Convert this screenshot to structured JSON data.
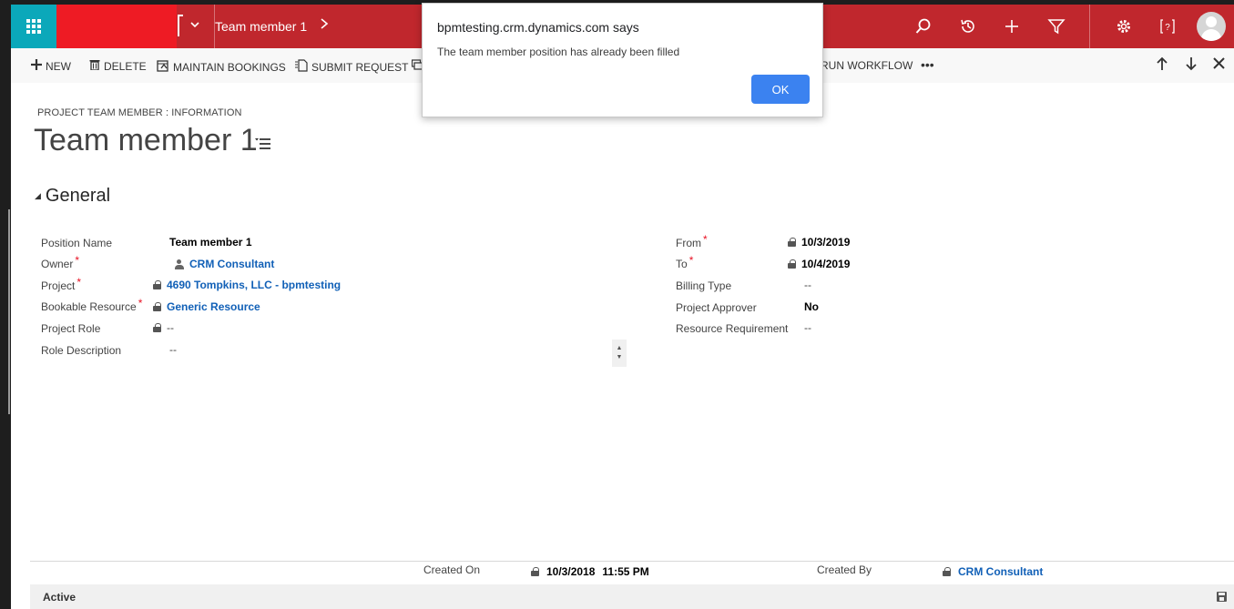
{
  "navbar": {
    "breadcrumb": "Team member 1",
    "icons": [
      "search-icon",
      "history-icon",
      "plus-icon",
      "filter-icon",
      "settings-icon",
      "help-icon",
      "avatar"
    ]
  },
  "commands": {
    "new": "NEW",
    "delete": "DELETE",
    "maintain_bookings": "MAINTAIN BOOKINGS",
    "submit_request": "SUBMIT REQUEST",
    "run_workflow": "RUN WORKFLOW",
    "more": "•••"
  },
  "header": {
    "entity_label": "PROJECT TEAM MEMBER : INFORMATION",
    "title": "Team member 1"
  },
  "section": {
    "title": "General"
  },
  "fields_left": {
    "position_name": {
      "label": "Position Name",
      "value": "Team member 1"
    },
    "owner": {
      "label": "Owner",
      "value": "CRM Consultant"
    },
    "project": {
      "label": "Project",
      "value": "4690 Tompkins, LLC - bpmtesting"
    },
    "bookable_resource": {
      "label": "Bookable Resource",
      "value": "Generic Resource"
    },
    "project_role": {
      "label": "Project Role",
      "value": "--"
    },
    "role_description": {
      "label": "Role Description",
      "value": "--"
    }
  },
  "fields_right": {
    "from": {
      "label": "From",
      "value": "10/3/2019"
    },
    "to": {
      "label": "To",
      "value": "10/4/2019"
    },
    "billing_type": {
      "label": "Billing Type",
      "value": "--"
    },
    "project_approver": {
      "label": "Project Approver",
      "value": "No"
    },
    "resource_requirement": {
      "label": "Resource Requirement",
      "value": "--"
    }
  },
  "required_marker": "*",
  "footer": {
    "created_on_label": "Created On",
    "created_on_date": "10/3/2018",
    "created_on_time": "11:55 PM",
    "created_by_label": "Created By",
    "created_by_value": "CRM Consultant",
    "status": "Active"
  },
  "dialog": {
    "title": "bpmtesting.crm.dynamics.com says",
    "message": "The team member position has already been filled",
    "ok": "OK"
  },
  "colors": {
    "navbar": "#c0272d",
    "waffle": "#0ba8ba",
    "redacted": "#ee1b24",
    "link": "#1160b7",
    "ok_button": "#3b82f0"
  }
}
